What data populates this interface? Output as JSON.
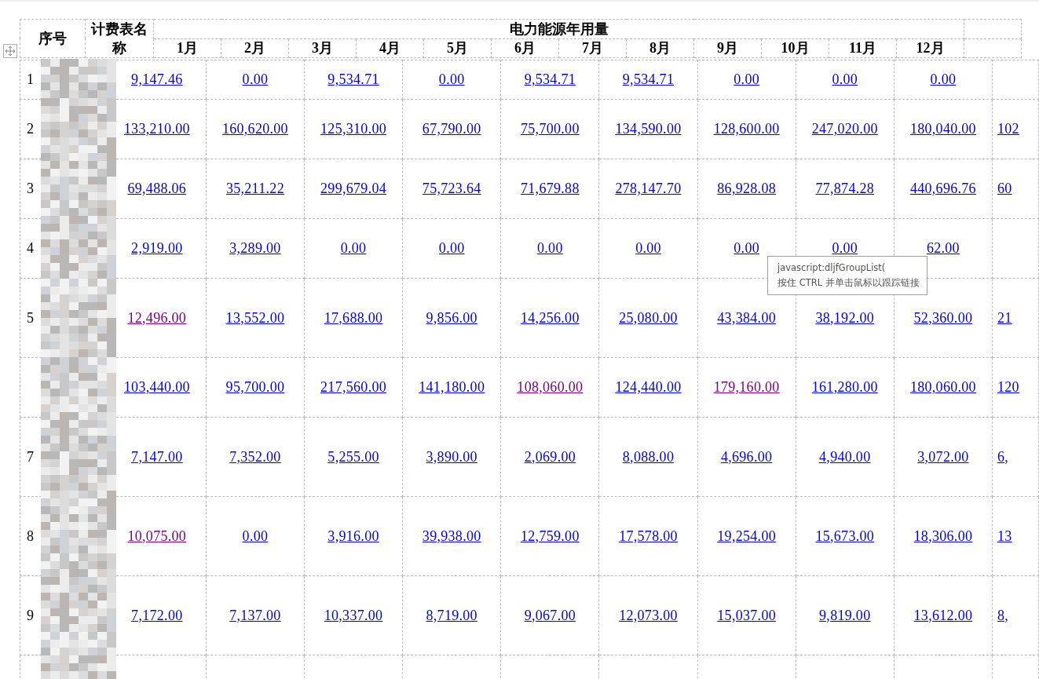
{
  "header": {
    "index": "序号",
    "name": "计费表名称",
    "group": "电力能源年用量",
    "months": [
      "1月",
      "2月",
      "3月",
      "4月",
      "5月",
      "6月",
      "7月",
      "8月",
      "9月",
      "10月",
      "11月",
      "12月"
    ]
  },
  "rows": [
    {
      "index": "1",
      "cells": [
        {
          "text": "9,147.46",
          "visited": false
        },
        {
          "text": "0.00",
          "visited": false
        },
        {
          "text": "9,534.71",
          "visited": false
        },
        {
          "text": "0.00",
          "visited": false
        },
        {
          "text": "9,534.71",
          "visited": false
        },
        {
          "text": "9,534.71",
          "visited": false
        },
        {
          "text": "0.00",
          "visited": false
        },
        {
          "text": "0.00",
          "visited": false
        },
        {
          "text": "0.00",
          "visited": false
        }
      ]
    },
    {
      "index": "2",
      "cells": [
        {
          "text": "133,210.00",
          "visited": false
        },
        {
          "text": "160,620.00",
          "visited": false
        },
        {
          "text": "125,310.00",
          "visited": false
        },
        {
          "text": "67,790.00",
          "visited": false
        },
        {
          "text": "75,700.00",
          "visited": false
        },
        {
          "text": "134,590.00",
          "visited": false
        },
        {
          "text": "128,600.00",
          "visited": false
        },
        {
          "text": "247,020.00",
          "visited": false
        },
        {
          "text": "180,040.00",
          "visited": false
        },
        {
          "text": "102",
          "visited": false
        }
      ]
    },
    {
      "index": "3",
      "cells": [
        {
          "text": "69,488.06",
          "visited": false
        },
        {
          "text": "35,211.22",
          "visited": false
        },
        {
          "text": "299,679.04",
          "visited": false
        },
        {
          "text": "75,723.64",
          "visited": false
        },
        {
          "text": "71,679.88",
          "visited": false
        },
        {
          "text": "278,147.70",
          "visited": false
        },
        {
          "text": "86,928.08",
          "visited": false
        },
        {
          "text": "77,874.28",
          "visited": false
        },
        {
          "text": "440,696.76",
          "visited": false
        },
        {
          "text": "60",
          "visited": false
        }
      ]
    },
    {
      "index": "4",
      "cells": [
        {
          "text": "2,919.00",
          "visited": false
        },
        {
          "text": "3,289.00",
          "visited": false
        },
        {
          "text": "0.00",
          "visited": false
        },
        {
          "text": "0.00",
          "visited": false
        },
        {
          "text": "0.00",
          "visited": false
        },
        {
          "text": "0.00",
          "visited": false
        },
        {
          "text": "0.00",
          "visited": false
        },
        {
          "text": "0.00",
          "visited": false
        },
        {
          "text": "62.00",
          "visited": false
        }
      ]
    },
    {
      "index": "5",
      "cells": [
        {
          "text": "12,496.00",
          "visited": true
        },
        {
          "text": "13,552.00",
          "visited": false
        },
        {
          "text": "17,688.00",
          "visited": false
        },
        {
          "text": "9,856.00",
          "visited": false
        },
        {
          "text": "14,256.00",
          "visited": false
        },
        {
          "text": "25,080.00",
          "visited": false
        },
        {
          "text": "43,384.00",
          "visited": false
        },
        {
          "text": "38,192.00",
          "visited": false
        },
        {
          "text": "52,360.00",
          "visited": false
        },
        {
          "text": "21",
          "visited": false
        }
      ]
    },
    {
      "cells": [
        {
          "text": "103,440.00",
          "visited": false
        },
        {
          "text": "95,700.00",
          "visited": false
        },
        {
          "text": "217,560.00",
          "visited": false
        },
        {
          "text": "141,180.00",
          "visited": false
        },
        {
          "text": "108,060.00",
          "visited": true
        },
        {
          "text": "124,440.00",
          "visited": false
        },
        {
          "text": "179,160.00",
          "visited": true
        },
        {
          "text": "161,280.00",
          "visited": false
        },
        {
          "text": "180,060.00",
          "visited": false
        },
        {
          "text": "120",
          "visited": false
        }
      ]
    },
    {
      "index": "7",
      "cells": [
        {
          "text": "7,147.00",
          "visited": false
        },
        {
          "text": "7,352.00",
          "visited": false
        },
        {
          "text": "5,255.00",
          "visited": false
        },
        {
          "text": "3,890.00",
          "visited": false
        },
        {
          "text": "2,069.00",
          "visited": false
        },
        {
          "text": "8,088.00",
          "visited": false
        },
        {
          "text": "4,696.00",
          "visited": false
        },
        {
          "text": "4,940.00",
          "visited": false
        },
        {
          "text": "3,072.00",
          "visited": false
        },
        {
          "text": "6,",
          "visited": false
        }
      ]
    },
    {
      "index": "8",
      "cells": [
        {
          "text": "10,075.00",
          "visited": true
        },
        {
          "text": "0.00",
          "visited": false
        },
        {
          "text": "3,916.00",
          "visited": false
        },
        {
          "text": "39,938.00",
          "visited": false
        },
        {
          "text": "12,759.00",
          "visited": false
        },
        {
          "text": "17,578.00",
          "visited": false
        },
        {
          "text": "19,254.00",
          "visited": false
        },
        {
          "text": "15,673.00",
          "visited": false
        },
        {
          "text": "18,306.00",
          "visited": false
        },
        {
          "text": "13",
          "visited": false
        }
      ]
    },
    {
      "index": "9",
      "cells": [
        {
          "text": "7,172.00",
          "visited": false
        },
        {
          "text": "7,137.00",
          "visited": false
        },
        {
          "text": "10,337.00",
          "visited": false
        },
        {
          "text": "8,719.00",
          "visited": false
        },
        {
          "text": "9,067.00",
          "visited": false
        },
        {
          "text": "12,073.00",
          "visited": false
        },
        {
          "text": "15,037.00",
          "visited": false
        },
        {
          "text": "9,819.00",
          "visited": false
        },
        {
          "text": "13,612.00",
          "visited": false
        },
        {
          "text": "8,",
          "visited": false
        }
      ]
    }
  ],
  "tooltip": {
    "lines": [
      "javascript:dljfGroupList(",
      "按住 CTRL 并单击鼠标以跟踪链接"
    ]
  }
}
